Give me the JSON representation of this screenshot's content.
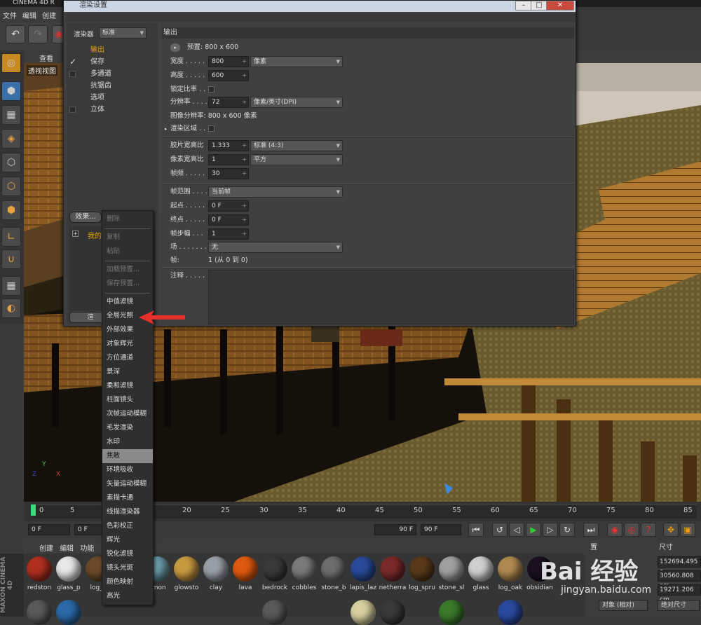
{
  "app_title": "CINEMA 4D R",
  "main_menu": [
    "文件",
    "编辑",
    "创建"
  ],
  "viewport": {
    "header_label": "查看",
    "view_label": "透视视图"
  },
  "render_settings": {
    "title": "渲染设置",
    "renderer_label": "渲染器",
    "renderer_value": "标准",
    "nav": [
      {
        "label": "输出",
        "checked": false,
        "active": true
      },
      {
        "label": "保存",
        "checked": true,
        "active": false
      },
      {
        "label": "多通道",
        "checked": false,
        "active": false
      },
      {
        "label": "抗锯齿",
        "checked": false,
        "active": false
      },
      {
        "label": "选项",
        "checked": false,
        "active": false
      },
      {
        "label": "立体",
        "checked": false,
        "active": false
      }
    ],
    "effects_button": "效果...",
    "multipass_item": "我的",
    "render_button": "渲",
    "section_title": "输出",
    "preset_label": "预置: 800 x 600",
    "width_label": "宽度 . . . . .",
    "width_value": "800",
    "width_unit": "像素",
    "height_label": "高度 . . . . .",
    "height_value": "600",
    "lock_ratio_label": "锁定比率 . .",
    "resolution_label": "分辨率 . . . .",
    "resolution_value": "72",
    "resolution_unit": "像素/英寸(DPI)",
    "image_resolution": "图像分辨率: 800 x 600 像素",
    "render_region_label": "渲染区域 . .",
    "film_aspect_label": "胶片宽高比",
    "film_aspect_value": "1.333",
    "film_aspect_preset": "标准 (4:3)",
    "pixel_aspect_label": "像素宽高比",
    "pixel_aspect_value": "1",
    "pixel_aspect_preset": "平方",
    "fps_label": "帧频 . . . . .",
    "fps_value": "30",
    "frame_range_label": "帧范围 . . . .",
    "frame_range_value": "当前帧",
    "start_label": "起点 . . . . .",
    "start_value": "0 F",
    "end_label": "终点 . . . . .",
    "end_value": "0 F",
    "frame_step_label": "帧步幅 . . .",
    "frame_step_value": "1",
    "field_label": "场 . . . . . . .",
    "field_value": "无",
    "frames_label": "帧:",
    "frames_value": "1 (从 0 到 0)",
    "notes_label": "注释 . . . . ."
  },
  "context_menu": {
    "items": [
      {
        "label": "删除",
        "disabled": true
      },
      {
        "sep": true
      },
      {
        "label": "复制",
        "disabled": true
      },
      {
        "label": "粘贴",
        "disabled": true
      },
      {
        "sep": true
      },
      {
        "label": "加载预置...",
        "disabled": true
      },
      {
        "label": "保存预置...",
        "disabled": true
      },
      {
        "sep": true
      },
      {
        "label": "中值滤镜"
      },
      {
        "label": "全局光照"
      },
      {
        "label": "外部效果"
      },
      {
        "label": "对象辉光"
      },
      {
        "label": "方位通道"
      },
      {
        "label": "景深"
      },
      {
        "label": "柔和滤镜"
      },
      {
        "label": "柱面镜头"
      },
      {
        "label": "次帧运动模糊"
      },
      {
        "label": "毛发渲染"
      },
      {
        "label": "水印"
      },
      {
        "label": "焦散",
        "highlighted": true
      },
      {
        "label": "环境吸收"
      },
      {
        "label": "矢量运动模糊"
      },
      {
        "label": "素描卡通"
      },
      {
        "label": "线描渲染器"
      },
      {
        "label": "色彩校正"
      },
      {
        "label": "辉光"
      },
      {
        "label": "锐化滤镜"
      },
      {
        "label": "镜头光斑"
      },
      {
        "label": "颜色映射"
      },
      {
        "label": "高光"
      }
    ]
  },
  "timeline": {
    "ticks": [
      "0",
      "5",
      "20",
      "25",
      "30",
      "35",
      "40",
      "45",
      "50",
      "55",
      "60",
      "65",
      "70",
      "75",
      "80",
      "85"
    ],
    "current_frame": "0 F",
    "start_field": "0 F",
    "end_field": "90 F",
    "end_field2": "90 F"
  },
  "materials_panel": {
    "menu": [
      "创建",
      "编辑",
      "功能"
    ],
    "items": [
      {
        "name": "redston",
        "color": "#b03020"
      },
      {
        "name": "glass_p",
        "color": "#e8e8e8"
      },
      {
        "name": "log_s",
        "color": "#6a4a28"
      },
      {
        "name": "",
        "color": "#8a8a8a"
      },
      {
        "name": "amon",
        "color": "#6a9aa8"
      },
      {
        "name": "glowsto",
        "color": "#c89a40"
      },
      {
        "name": "clay",
        "color": "#9aa0aa"
      },
      {
        "name": "lava",
        "color": "#e05a10"
      },
      {
        "name": "bedrock",
        "color": "#3a3a3a"
      },
      {
        "name": "cobbles",
        "color": "#7a7a7a"
      },
      {
        "name": "stone_b",
        "color": "#6e6e6e"
      },
      {
        "name": "lapis_laz",
        "color": "#2a4a9a"
      },
      {
        "name": "netherra",
        "color": "#7a2a2a"
      },
      {
        "name": "log_spru",
        "color": "#5a3a1a"
      },
      {
        "name": "stone_sl",
        "color": "#a0a0a0"
      },
      {
        "name": "glass",
        "color": "#d0d0d0"
      },
      {
        "name": "log_oak",
        "color": "#b08a50"
      },
      {
        "name": "obsidian",
        "color": "#1a1020"
      }
    ]
  },
  "maxon_label": "MAXON CINEMA 4D",
  "coordinates": {
    "header_pos": "置",
    "header_size": "尺寸",
    "values": [
      "152694.495 c",
      "30560.808 cm",
      "19271.206 cm"
    ],
    "mode_button": "对象 (相对)",
    "size_button": "绝对尺寸"
  },
  "watermark": {
    "brand": "Bai 经验",
    "url": "jingyan.baidu.com"
  }
}
